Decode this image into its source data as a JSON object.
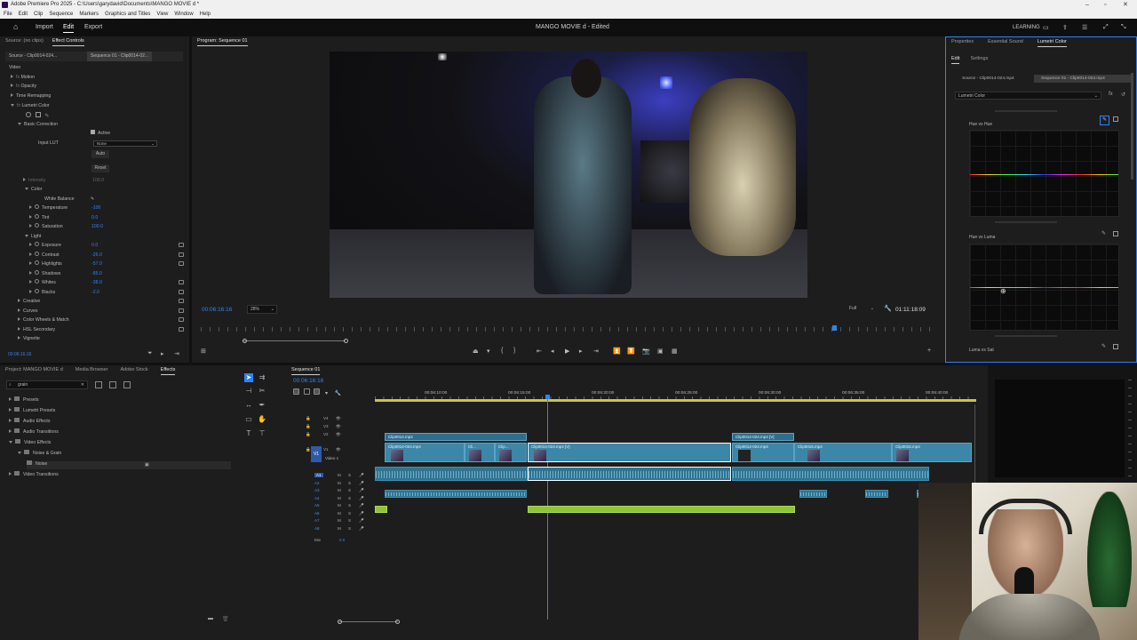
{
  "window": {
    "title": "Adobe Premiere Pro 2025 - C:\\Users\\garydavid\\Documents\\MANGO MOVIE d *",
    "menu": [
      "File",
      "Edit",
      "Clip",
      "Sequence",
      "Markers",
      "Graphics and Titles",
      "View",
      "Window",
      "Help"
    ]
  },
  "appbar": {
    "tabs": [
      "Import",
      "Edit",
      "Export"
    ],
    "active_tab": "Edit",
    "project_title": "MANGO MOVIE d - Edited",
    "learning": "LEARNING"
  },
  "effect_controls": {
    "tabs": [
      "Source: (no clips)",
      "Effect Controls"
    ],
    "source_label": "Source - Clip0014-024...",
    "sequence_label": "Sequence 01 - Clip0014-02...",
    "video_heading": "Video",
    "effects": [
      "Motion",
      "Opacity",
      "Time Remapping",
      "Lumetri Color"
    ],
    "basic_correction": "Basic Correction",
    "active_label": "Active",
    "input_lut_label": "Input LUT",
    "input_lut_value": "None",
    "auto_button": "Auto",
    "reset_button": "Reset",
    "intensity_label": "Intensity",
    "intensity_value": "100.0",
    "color_heading": "Color",
    "white_balance": "White Balance",
    "color_params": [
      {
        "label": "Temperature",
        "value": "-100"
      },
      {
        "label": "Tint",
        "value": "0.0"
      },
      {
        "label": "Saturation",
        "value": "100.0"
      }
    ],
    "light_heading": "Light",
    "light_params": [
      {
        "label": "Exposure",
        "value": "0.0"
      },
      {
        "label": "Contrast",
        "value": "-26.0"
      },
      {
        "label": "Highlights",
        "value": "-57.0"
      },
      {
        "label": "Shadows",
        "value": "-85.0"
      },
      {
        "label": "Whites",
        "value": "-38.0"
      },
      {
        "label": "Blacks",
        "value": "-2.0"
      }
    ],
    "sections": [
      "Creative",
      "Curves",
      "Color Wheels & Match",
      "HSL Secondary",
      "Vignette"
    ],
    "timecode": "00:06:16:16"
  },
  "program": {
    "tab": "Program: Sequence 01",
    "timecode": "00:06:16:16",
    "zoom": "28%",
    "resolution": "Full",
    "duration": "01:11:18:09"
  },
  "lumetri": {
    "tabs": [
      "Properties",
      "Essential Sound",
      "Lumetri Color"
    ],
    "subtabs": [
      "Edit",
      "Settings"
    ],
    "source_label": "Source - Clip0014-024.mp4",
    "sequence_label": "Sequence 01 - Clip0014-024.mp4",
    "dropdown": "Lumetri Color",
    "curves": [
      "Hue vs Hue",
      "Hue vs Luma",
      "Luma vs Sat"
    ]
  },
  "project": {
    "tabs": [
      "Project: MANGO MOVIE d",
      "Media Browser",
      "Adobe Stock",
      "Effects"
    ],
    "search_value": "grain",
    "tree": [
      {
        "label": "Presets",
        "level": 0
      },
      {
        "label": "Lumetri Presets",
        "level": 0
      },
      {
        "label": "Audio Effects",
        "level": 0
      },
      {
        "label": "Audio Transitions",
        "level": 0
      },
      {
        "label": "Video Effects",
        "level": 0
      },
      {
        "label": "Noise & Grain",
        "level": 1
      },
      {
        "label": "Noise",
        "level": 2
      },
      {
        "label": "Video Transitions",
        "level": 0
      }
    ]
  },
  "timeline": {
    "tab": "Sequence 01",
    "timecode": "00:06:16:16",
    "ruler": [
      "00:06:10:00",
      "00:06:15:00",
      "00:06:20:00",
      "00:06:25:00",
      "00:06:30:00",
      "00:06:35:00",
      "00:06:40:00"
    ],
    "video_tracks": [
      "V4",
      "V3",
      "V2",
      "V1"
    ],
    "audio_tracks": [
      "A1",
      "A2",
      "A3",
      "A4",
      "A5",
      "A6",
      "A7",
      "A8"
    ],
    "mix_label": "Mix",
    "mix_value": "0.0",
    "video1_label": "Video 1",
    "v2_clips": [
      "Clip0014.mp4",
      "Clip0014-024.mp4 [V]"
    ],
    "v1_clips": [
      "Clip0014-024.mp4",
      "Cli...",
      "Clip...",
      "Clip0014-024.mp4 [V]",
      "Clip0014-024.mp4",
      "Clip0015.mp4",
      "Clip0015.mp4"
    ]
  },
  "colors": {
    "accent": "#2f83f5",
    "clip": "#3c86a8",
    "audio_green": "#8fc43a"
  }
}
